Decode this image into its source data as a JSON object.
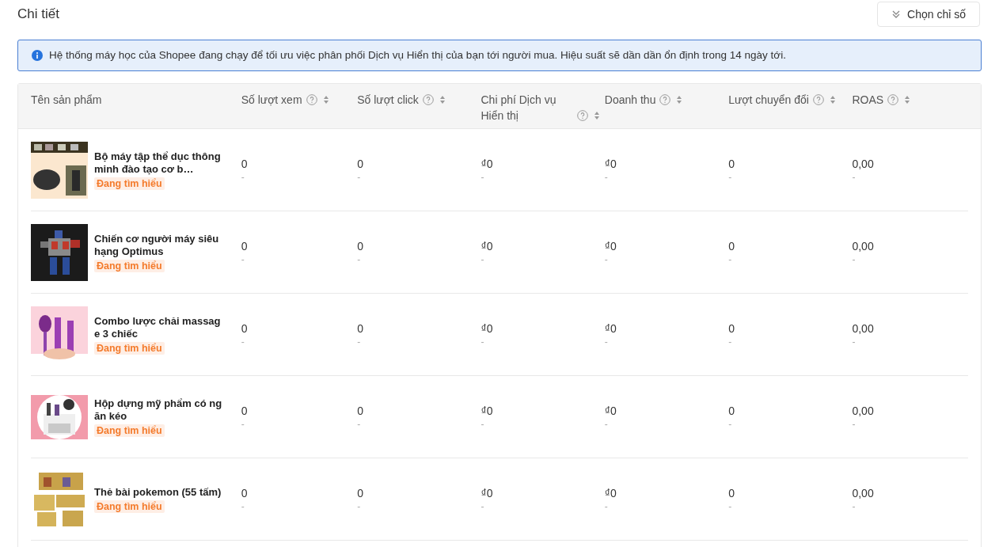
{
  "title": "Chi tiết",
  "select_metrics_button": {
    "label": "Chọn chỉ số"
  },
  "info_banner": {
    "text": "Hệ thống máy học của Shopee đang chạy để tối ưu việc phân phối Dịch vụ Hiển thị của bạn tới người mua. Hiệu suất sẽ dần dần ổn định trong 14 ngày tới."
  },
  "table": {
    "columns": [
      {
        "label": "Tên sản phẩm",
        "sortable": false
      },
      {
        "label": "Số lượt xem",
        "sortable": true
      },
      {
        "label": "Số lượt click",
        "sortable": true
      },
      {
        "label": "Chi phí Dịch vụ Hiển thị",
        "sortable": true
      },
      {
        "label": "Doanh thu",
        "sortable": true
      },
      {
        "label": "Lượt chuyển đổi",
        "sortable": true
      },
      {
        "label": "ROAS",
        "sortable": true
      }
    ],
    "rows": [
      {
        "cells": [
          {
            "kind": "product",
            "name": "Bộ máy tập thể dục thông minh đào tạo cơ b…",
            "status": "Đang tìm hiểu"
          },
          {
            "kind": "metric",
            "value": "0",
            "change": "-"
          },
          {
            "kind": "metric",
            "value": "0",
            "change": "-"
          },
          {
            "kind": "metric",
            "value": "₫0",
            "change": "-"
          },
          {
            "kind": "metric",
            "value": "₫0",
            "change": "-"
          },
          {
            "kind": "metric",
            "value": "0",
            "change": "-"
          },
          {
            "kind": "metric",
            "value": "0,00",
            "change": "-"
          }
        ]
      },
      {
        "cells": [
          {
            "kind": "product",
            "name": "Chiến cơ người máy siêu hạng Optimus",
            "status": "Đang tìm hiểu"
          },
          {
            "kind": "metric",
            "value": "0",
            "change": "-"
          },
          {
            "kind": "metric",
            "value": "0",
            "change": "-"
          },
          {
            "kind": "metric",
            "value": "₫0",
            "change": "-"
          },
          {
            "kind": "metric",
            "value": "₫0",
            "change": "-"
          },
          {
            "kind": "metric",
            "value": "0",
            "change": "-"
          },
          {
            "kind": "metric",
            "value": "0,00",
            "change": "-"
          }
        ]
      },
      {
        "cells": [
          {
            "kind": "product",
            "name": "Combo lược chải massage 3 chiếc",
            "status": "Đang tìm hiểu"
          },
          {
            "kind": "metric",
            "value": "0",
            "change": "-"
          },
          {
            "kind": "metric",
            "value": "0",
            "change": "-"
          },
          {
            "kind": "metric",
            "value": "₫0",
            "change": "-"
          },
          {
            "kind": "metric",
            "value": "₫0",
            "change": "-"
          },
          {
            "kind": "metric",
            "value": "0",
            "change": "-"
          },
          {
            "kind": "metric",
            "value": "0,00",
            "change": "-"
          }
        ]
      },
      {
        "cells": [
          {
            "kind": "product",
            "name": "Hộp dựng mỹ phẩm có ngăn kéo",
            "status": "Đang tìm hiểu"
          },
          {
            "kind": "metric",
            "value": "0",
            "change": "-"
          },
          {
            "kind": "metric",
            "value": "0",
            "change": "-"
          },
          {
            "kind": "metric",
            "value": "₫0",
            "change": "-"
          },
          {
            "kind": "metric",
            "value": "₫0",
            "change": "-"
          },
          {
            "kind": "metric",
            "value": "0",
            "change": "-"
          },
          {
            "kind": "metric",
            "value": "0,00",
            "change": "-"
          }
        ]
      },
      {
        "cells": [
          {
            "kind": "product",
            "name": "Thẻ bài pokemon (55 tấm)",
            "status": "Đang tìm hiểu"
          },
          {
            "kind": "metric",
            "value": "0",
            "change": "-"
          },
          {
            "kind": "metric",
            "value": "0",
            "change": "-"
          },
          {
            "kind": "metric",
            "value": "₫0",
            "change": "-"
          },
          {
            "kind": "metric",
            "value": "₫0",
            "change": "-"
          },
          {
            "kind": "metric",
            "value": "0",
            "change": "-"
          },
          {
            "kind": "metric",
            "value": "0,00",
            "change": "-"
          }
        ]
      }
    ]
  }
}
